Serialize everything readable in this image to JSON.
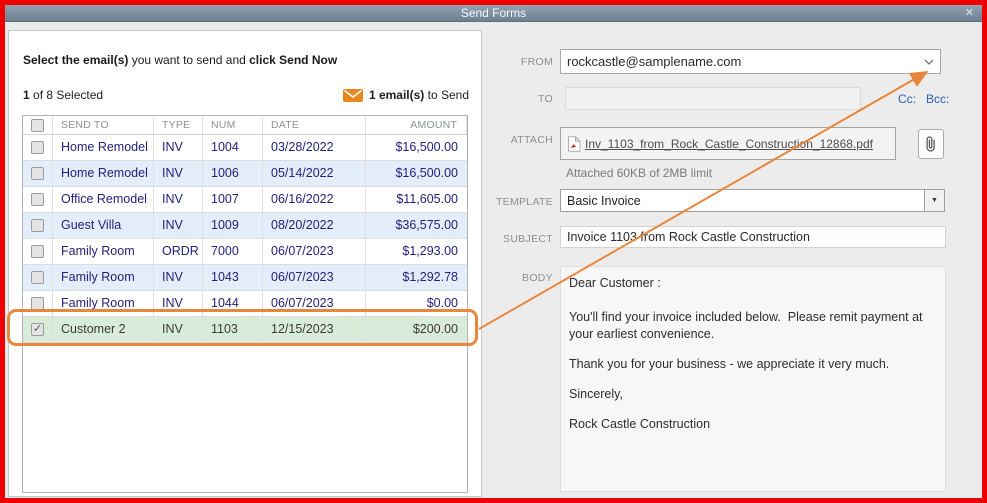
{
  "dialog": {
    "title": "Send Forms",
    "close_icon": "✕"
  },
  "icons": {
    "check": "✓",
    "dropdown": "▼"
  },
  "left_panel": {
    "instruction": {
      "part1_bold": "Select the email(s)",
      "part2": " you want to send and ",
      "part3_bold": "click Send Now"
    },
    "selected_count_bold": "1",
    "selected_count_rest": " of 8 Selected",
    "send_count_bold": "1 email(s)",
    "send_count_rest": " to Send",
    "table": {
      "headers": [
        "SEND TO",
        "TYPE",
        "NUM",
        "DATE",
        "AMOUNT"
      ],
      "rows": [
        {
          "send_to": "Home Remodel",
          "type": "INV",
          "num": "1004",
          "date": "03/28/2022",
          "amount": "$16,500.00",
          "checked": false
        },
        {
          "send_to": "Home Remodel",
          "type": "INV",
          "num": "1006",
          "date": "05/14/2022",
          "amount": "$16,500.00",
          "checked": false
        },
        {
          "send_to": "Office Remodel",
          "type": "INV",
          "num": "1007",
          "date": "06/16/2022",
          "amount": "$11,605.00",
          "checked": false
        },
        {
          "send_to": "Guest Villa",
          "type": "INV",
          "num": "1009",
          "date": "08/20/2022",
          "amount": "$36,575.00",
          "checked": false
        },
        {
          "send_to": "Family Room",
          "type": "ORDR",
          "num": "7000",
          "date": "06/07/2023",
          "amount": "$1,293.00",
          "checked": false
        },
        {
          "send_to": "Family Room",
          "type": "INV",
          "num": "1043",
          "date": "06/07/2023",
          "amount": "$1,292.78",
          "checked": false
        },
        {
          "send_to": "Family Room",
          "type": "INV",
          "num": "1044",
          "date": "06/07/2023",
          "amount": "$0.00",
          "checked": false
        },
        {
          "send_to": "Customer 2",
          "type": "INV",
          "num": "1103",
          "date": "12/15/2023",
          "amount": "$200.00",
          "checked": true
        }
      ]
    }
  },
  "form": {
    "from": {
      "label": "FROM",
      "value": "rockcastle@samplename.com"
    },
    "to": {
      "label": "TO",
      "value": "",
      "cc_label": "Cc:",
      "bcc_label": "Bcc:"
    },
    "attach": {
      "label": "ATTACH",
      "filename": "Inv_1103_from_Rock_Castle_Construction_12868.pdf",
      "note": "Attached 60KB of 2MB limit"
    },
    "template": {
      "label": "TEMPLATE",
      "value": "Basic Invoice"
    },
    "subject": {
      "label": "SUBJECT",
      "value": "Invoice 1103 from Rock Castle Construction"
    },
    "body": {
      "label": "BODY",
      "lines": [
        "Dear Customer :",
        "You'll find your invoice included below.  Please remit payment at your earliest convenience.",
        "Thank you for your business - we appreciate it very much.",
        "Sincerely,",
        "Rock Castle Construction"
      ]
    }
  },
  "colors": {
    "annotation_orange": "#e8873b",
    "frame_red": "#ee0000",
    "row_text_navy": "#22227e",
    "row_alt_blue": "#e4edfa",
    "row_selected_green": "#d9ecd9",
    "titlebar_blue_gray": "#7e91a1"
  }
}
